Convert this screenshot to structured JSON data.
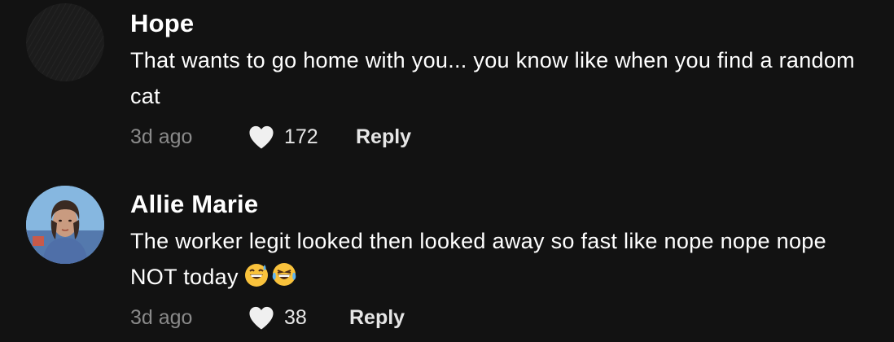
{
  "comments": [
    {
      "username": "Hope",
      "text": "That wants to go home with you... you know like when you find a random cat",
      "time": "3d ago",
      "likes": "172",
      "reply_label": "Reply",
      "avatar": "dark-textured-avatar"
    },
    {
      "username": "Allie Marie",
      "text": "The worker legit looked then looked away so fast like nope nope nope NOT today",
      "emojis": [
        "grinning-sweat-emoji",
        "tears-of-joy-emoji"
      ],
      "time": "3d ago",
      "likes": "38",
      "reply_label": "Reply",
      "avatar": "profile-photo-avatar"
    }
  ],
  "colors": {
    "background": "#121212",
    "primary_text": "#ffffff",
    "secondary_text": "#8a8a8a"
  },
  "icons": {
    "like": "heart-icon"
  }
}
